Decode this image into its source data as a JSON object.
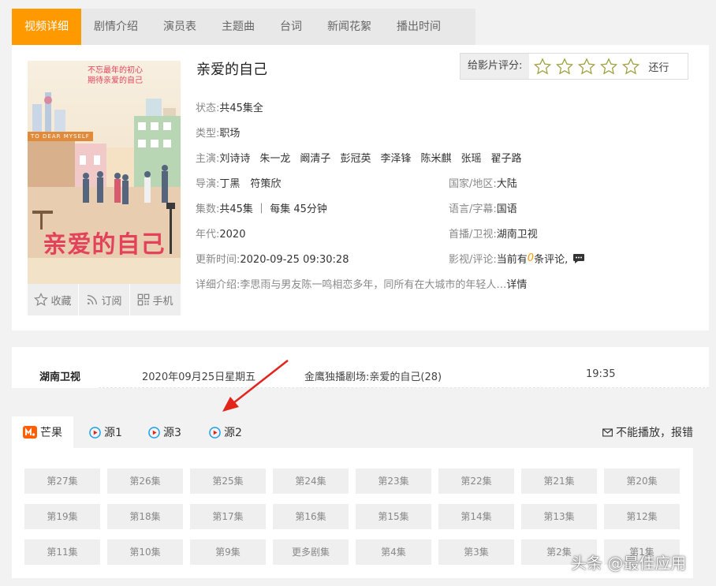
{
  "tabs": [
    {
      "label": "视频详细",
      "active": true
    },
    {
      "label": "剧情介绍",
      "active": false
    },
    {
      "label": "演员表",
      "active": false
    },
    {
      "label": "主题曲",
      "active": false
    },
    {
      "label": "台词",
      "active": false
    },
    {
      "label": "新闻花絮",
      "active": false
    },
    {
      "label": "播出时间",
      "active": false
    }
  ],
  "poster": {
    "tagline_1": "不忘最年的初心",
    "tagline_2": "期待亲爱的自己",
    "banner": "TO DEAR MYSELF",
    "title_art": "亲爱的自己"
  },
  "actions": {
    "favorite": "收藏",
    "subscribe": "订阅",
    "mobile": "手机"
  },
  "show": {
    "title": "亲爱的自己",
    "status_label": "状态:",
    "status": "共45集全",
    "genre_label": "类型:",
    "genre": "职场",
    "cast_label": "主演:",
    "cast": [
      "刘诗诗",
      "朱一龙",
      "阚清子",
      "彭冠英",
      "李泽锋",
      "陈米麒",
      "张瑶",
      "翟子路"
    ],
    "director_label": "导演:",
    "directors": "丁黑　符策欣",
    "country_label": "国家/地区:",
    "country": "大陆",
    "episodes_label": "集数:",
    "episodes": "共45集 ｜ 每集 45分钟",
    "language_label": "语言/字幕:",
    "language": "国语",
    "year_label": "年代:",
    "year": "2020",
    "channel_label": "首播/卫视:",
    "channel": "湖南卫视",
    "updated_label": "更新时间:",
    "updated": "2020-09-25 09:30:28",
    "review_label": "影视/评论:",
    "review_prefix": "当前有",
    "review_count": "0",
    "review_suffix": "条评论,",
    "summary_label": "详细介绍:",
    "summary": "李思雨与男友陈一鸣相恋多年，同所有在大城市的年轻人…",
    "more": "详情"
  },
  "rating": {
    "label": "给影片评分:",
    "stars": 5,
    "word": "还行"
  },
  "broadcast": {
    "channel": "湖南卫视",
    "date": "2020年09月25日星期五",
    "program": "金鹰独播剧场:亲爱的自己(28)",
    "time": "19:35"
  },
  "sources": [
    {
      "label": "芒果",
      "icon": "mango-icon",
      "active": true
    },
    {
      "label": "源1",
      "icon": "play-icon",
      "active": false
    },
    {
      "label": "源3",
      "icon": "play-icon",
      "active": false
    },
    {
      "label": "源2",
      "icon": "play-icon",
      "active": false
    }
  ],
  "report_label": "不能播放，报错",
  "episode_rows": [
    [
      "第27集",
      "第26集",
      "第25集",
      "第24集",
      "第23集",
      "第22集",
      "第21集",
      "第20集"
    ],
    [
      "第19集",
      "第18集",
      "第17集",
      "第16集",
      "第15集",
      "第14集",
      "第13集",
      "第12集"
    ],
    [
      "第11集",
      "第10集",
      "第9集",
      "更多剧集",
      "第4集",
      "第3集",
      "第2集",
      "第1集"
    ]
  ],
  "colors": {
    "accent": "#ff9900",
    "accent_red": "#e2435b",
    "mango": "#ff5f00",
    "play": "#1aa0e8"
  },
  "watermark": "头条 @最佳应用"
}
